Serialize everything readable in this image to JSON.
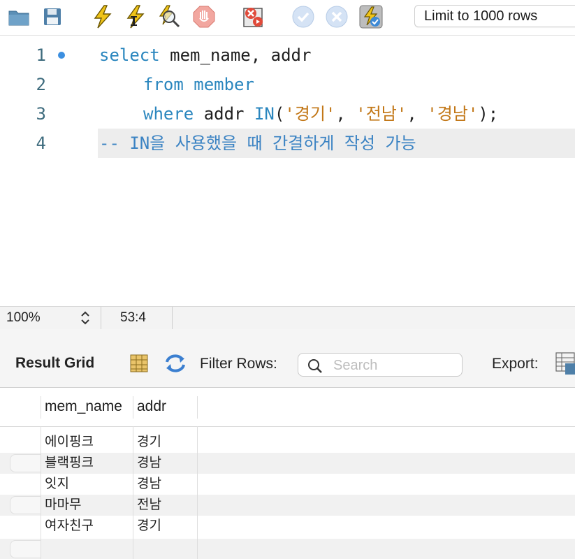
{
  "toolbar": {
    "limit_select": {
      "value": "Limit to 1000 rows"
    },
    "icons": [
      "open-folder-icon",
      "save-icon",
      "execute-icon",
      "execute-current-icon",
      "explain-icon",
      "stop-icon",
      "toggle-error-icon",
      "commit-icon",
      "rollback-icon",
      "autocommit-icon"
    ]
  },
  "editor": {
    "line_numbers": [
      "1",
      "2",
      "3",
      "4"
    ],
    "lines": [
      {
        "kw1": "select",
        "rest": " mem_name, addr"
      },
      {
        "kw1": "from",
        "sp": " ",
        "kw2": "member"
      },
      {
        "kw1": "where",
        "txt": " addr ",
        "kw2": "IN",
        "p1": "(",
        "s1": "'경기'",
        "c1": ", ",
        "s2": "'전남'",
        "c2": ", ",
        "s3": "'경남'",
        "end": ");"
      },
      {
        "comment": "-- IN을 사용했을 때 간결하게 작성 가능"
      }
    ]
  },
  "status": {
    "zoom": "100%",
    "cursor_position": "53:4"
  },
  "result": {
    "title": "Result Grid",
    "filter_label": "Filter Rows:",
    "search_placeholder": "Search",
    "export_label": "Export:",
    "columns": [
      "mem_name",
      "addr"
    ],
    "rows": [
      [
        "에이핑크",
        "경기"
      ],
      [
        "블랙핑크",
        "경남"
      ],
      [
        "잇지",
        "경남"
      ],
      [
        "마마무",
        "전남"
      ],
      [
        "여자친구",
        "경기"
      ]
    ]
  },
  "colors": {
    "keyword": "#2a86be",
    "string": "#c27717",
    "comment": "#3b83c3",
    "line_number": "#3d6b7d"
  }
}
